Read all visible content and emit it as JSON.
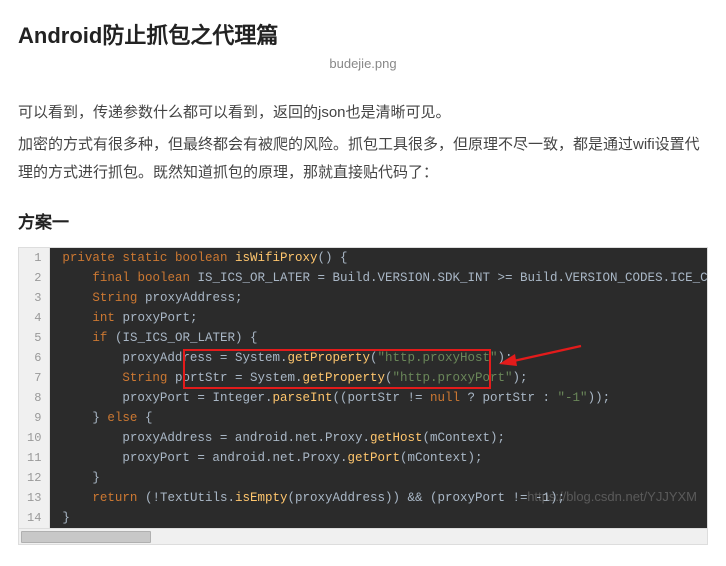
{
  "title": "Android防止抓包之代理篇",
  "caption": "budejie.png",
  "paragraphs": [
    "可以看到，传递参数什么都可以看到，返回的json也是清晰可见。",
    "加密的方式有很多种，但最终都会有被爬的风险。抓包工具很多，但原理不尽一致，都是通过wifi设置代理的方式进行抓包。既然知道抓包的原理，那就直接贴代码了："
  ],
  "h2": "方案一",
  "code": {
    "lines": [
      [
        {
          "t": "private ",
          "c": "kw"
        },
        {
          "t": "static ",
          "c": "kw"
        },
        {
          "t": "boolean ",
          "c": "kw"
        },
        {
          "t": "isWifiProxy",
          "c": "id"
        },
        {
          "t": "() {",
          "c": "op"
        }
      ],
      [
        {
          "t": "    ",
          "c": ""
        },
        {
          "t": "final ",
          "c": "kw"
        },
        {
          "t": "boolean ",
          "c": "kw"
        },
        {
          "t": "IS_ICS_OR_LATER = ",
          "c": "cls"
        },
        {
          "t": "Build",
          "c": "cls"
        },
        {
          "t": ".VERSION.SDK_INT >= ",
          "c": "op"
        },
        {
          "t": "Build",
          "c": "cls"
        },
        {
          "t": ".VERSION_CODES.ICE_CREAM_SANDWI",
          "c": "op"
        }
      ],
      [
        {
          "t": "    ",
          "c": ""
        },
        {
          "t": "String ",
          "c": "kw"
        },
        {
          "t": "proxyAddress;",
          "c": "cls"
        }
      ],
      [
        {
          "t": "    ",
          "c": ""
        },
        {
          "t": "int ",
          "c": "kw"
        },
        {
          "t": "proxyPort;",
          "c": "cls"
        }
      ],
      [
        {
          "t": "    ",
          "c": ""
        },
        {
          "t": "if ",
          "c": "kw"
        },
        {
          "t": "(IS_ICS_OR_LATER) {",
          "c": "op"
        }
      ],
      [
        {
          "t": "        proxyAddress = ",
          "c": "cls"
        },
        {
          "t": "System",
          "c": "cls"
        },
        {
          "t": ".",
          "c": "op"
        },
        {
          "t": "getProperty",
          "c": "fn"
        },
        {
          "t": "(",
          "c": "op"
        },
        {
          "t": "\"http.proxyHost\"",
          "c": "str"
        },
        {
          "t": ");",
          "c": "op"
        }
      ],
      [
        {
          "t": "        ",
          "c": ""
        },
        {
          "t": "String ",
          "c": "kw"
        },
        {
          "t": "portStr = ",
          "c": "cls"
        },
        {
          "t": "System",
          "c": "cls"
        },
        {
          "t": ".",
          "c": "op"
        },
        {
          "t": "getProperty",
          "c": "fn"
        },
        {
          "t": "(",
          "c": "op"
        },
        {
          "t": "\"http.proxyPort\"",
          "c": "str"
        },
        {
          "t": ");",
          "c": "op"
        }
      ],
      [
        {
          "t": "        proxyPort = ",
          "c": "cls"
        },
        {
          "t": "Integer",
          "c": "cls"
        },
        {
          "t": ".",
          "c": "op"
        },
        {
          "t": "parseInt",
          "c": "fn"
        },
        {
          "t": "((portStr != ",
          "c": "op"
        },
        {
          "t": "null ",
          "c": "kw"
        },
        {
          "t": "? portStr : ",
          "c": "op"
        },
        {
          "t": "\"-1\"",
          "c": "str"
        },
        {
          "t": "));",
          "c": "op"
        }
      ],
      [
        {
          "t": "    } ",
          "c": "op"
        },
        {
          "t": "else ",
          "c": "kw"
        },
        {
          "t": "{",
          "c": "op"
        }
      ],
      [
        {
          "t": "        proxyAddress = android.net.Proxy.",
          "c": "cls"
        },
        {
          "t": "getHost",
          "c": "fn"
        },
        {
          "t": "(mContext);",
          "c": "op"
        }
      ],
      [
        {
          "t": "        proxyPort = android.net.Proxy.",
          "c": "cls"
        },
        {
          "t": "getPort",
          "c": "fn"
        },
        {
          "t": "(mContext);",
          "c": "op"
        }
      ],
      [
        {
          "t": "    }",
          "c": "op"
        }
      ],
      [
        {
          "t": "    ",
          "c": ""
        },
        {
          "t": "return ",
          "c": "kw"
        },
        {
          "t": "(!",
          "c": "op"
        },
        {
          "t": "TextUtils",
          "c": "cls"
        },
        {
          "t": ".",
          "c": "op"
        },
        {
          "t": "isEmpty",
          "c": "fn"
        },
        {
          "t": "(proxyAddress)) && (proxyPort != -",
          "c": "op"
        },
        {
          "t": "1",
          "c": "cls"
        },
        {
          "t": ");",
          "c": "op"
        }
      ],
      [
        {
          "t": "}",
          "c": "op"
        }
      ]
    ]
  },
  "watermark": "https://blog.csdn.net/YJJYXM"
}
